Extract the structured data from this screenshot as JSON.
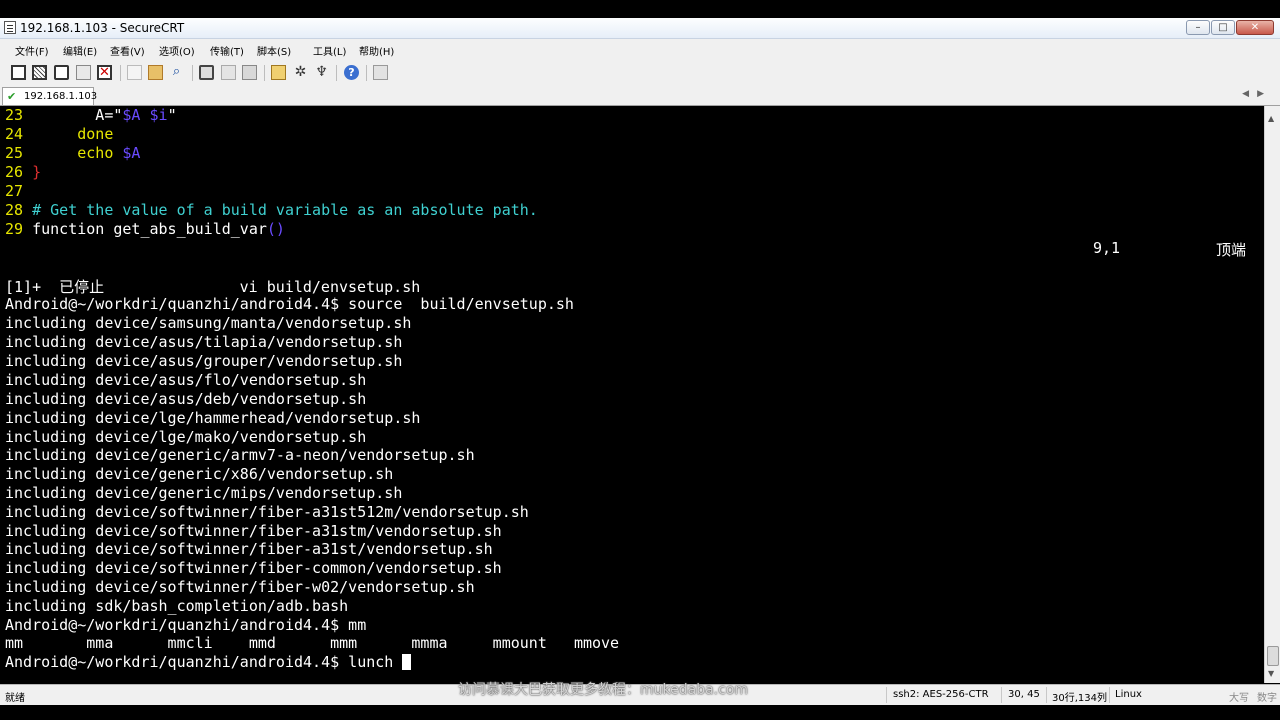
{
  "window": {
    "title": "192.168.1.103 - SecureCRT"
  },
  "menu": [
    "文件(F)",
    "编辑(E)",
    "查看(V)",
    "选项(O)",
    "传输(T)",
    "脚本(S)",
    "工具(L)",
    "帮助(H)"
  ],
  "toolbar_icons": [
    "connect-icon",
    "quick-connect-icon",
    "connect-tab-icon",
    "reconnect-icon",
    "disconnect-icon",
    "copy-icon",
    "paste-icon",
    "find-icon",
    "print-icon",
    "print-setup-icon",
    "print-screen-icon",
    "session-options-icon",
    "global-options-icon",
    "keymap-icon",
    "help-icon",
    "sftp-icon"
  ],
  "tab": {
    "label": "192.168.1.103"
  },
  "vim": {
    "lines": [
      {
        "num": "23",
        "pre": "        A=\"",
        "v1": "$A",
        "sp": " ",
        "v2": "$i",
        "post": "\""
      },
      {
        "num": "24",
        "text": "      done"
      },
      {
        "num": "25",
        "text": "      echo ",
        "var": "$A"
      },
      {
        "num": "26",
        "brace": "}"
      },
      {
        "num": "27"
      },
      {
        "num": "28",
        "comment": "# Get the value of a build variable as an absolute path."
      },
      {
        "num": "29",
        "text": "function get_abs_build_var",
        "paren": "()"
      }
    ],
    "position": "9,1",
    "scroll": "顶端"
  },
  "shell": [
    "[1]+  已停止               vi build/envsetup.sh",
    "Android@~/workdri/quanzhi/android4.4$ source  build/envsetup.sh",
    "including device/samsung/manta/vendorsetup.sh",
    "including device/asus/tilapia/vendorsetup.sh",
    "including device/asus/grouper/vendorsetup.sh",
    "including device/asus/flo/vendorsetup.sh",
    "including device/asus/deb/vendorsetup.sh",
    "including device/lge/hammerhead/vendorsetup.sh",
    "including device/lge/mako/vendorsetup.sh",
    "including device/generic/armv7-a-neon/vendorsetup.sh",
    "including device/generic/x86/vendorsetup.sh",
    "including device/generic/mips/vendorsetup.sh",
    "including device/softwinner/fiber-a31st512m/vendorsetup.sh",
    "including device/softwinner/fiber-a31stm/vendorsetup.sh",
    "including device/softwinner/fiber-a31st/vendorsetup.sh",
    "including device/softwinner/fiber-common/vendorsetup.sh",
    "including device/softwinner/fiber-w02/vendorsetup.sh",
    "including sdk/bash_completion/adb.bash",
    "Android@~/workdri/quanzhi/android4.4$ mm",
    "mm       mma      mmcli    mmd      mmm      mmma     mmount   mmove"
  ],
  "prompt": {
    "text": "Android@~/workdri/quanzhi/android4.4$ lunch "
  },
  "status": {
    "ready": "就绪",
    "cipher": "ssh2: AES-256-CTR",
    "cursor": "30, 45",
    "size": "30行,134列",
    "os": "Linux",
    "caps": "大写",
    "num": "数字"
  },
  "watermark": "访问慕课大巴获取更多教程：mukedaba.com"
}
